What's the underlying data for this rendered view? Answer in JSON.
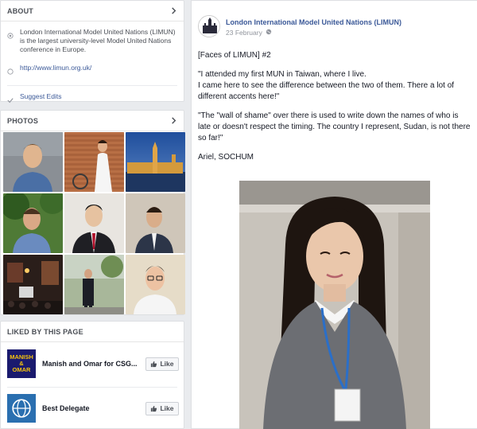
{
  "about": {
    "title": "ABOUT",
    "description": "London International Model United Nations (LIMUN) is the largest university-level Model United Nations conference in Europe.",
    "website": "http://www.limun.org.uk/",
    "suggest_edits": "Suggest Edits"
  },
  "photos": {
    "title": "PHOTOS",
    "items": [
      "photo-1",
      "photo-2",
      "photo-3",
      "photo-4",
      "photo-5",
      "photo-6",
      "photo-7",
      "photo-8",
      "photo-9"
    ]
  },
  "liked": {
    "title": "LIKED BY THIS PAGE",
    "items": [
      {
        "name": "Manish and Omar for CSG...",
        "logo_text_1": "MANISH",
        "logo_text_2": "&",
        "logo_text_3": "OMAR",
        "button": "Like"
      },
      {
        "name": "Best Delegate",
        "button": "Like"
      }
    ]
  },
  "post": {
    "author": "London International Model United Nations (LIMUN)",
    "date": "23 February",
    "paragraphs": [
      "[Faces of LIMUN] #2",
      "\"I attended my first MUN in Taiwan, where I live.\nI came here to see the difference between the two of them. There a lot of different accents here!\"",
      "\"The \"wall of shame\" over there is used to write down the names of who is late or doesn't respect the timing. The country I represent, Sudan, is not there so far!\"",
      "Ariel, SOCHUM"
    ]
  },
  "colors": {
    "link": "#3b5998",
    "background": "#e9ebee",
    "manish_logo_bg": "#1a1a6e",
    "manish_logo_text": "#f4c20d",
    "best_delegate_bg": "#2a6fb0"
  }
}
